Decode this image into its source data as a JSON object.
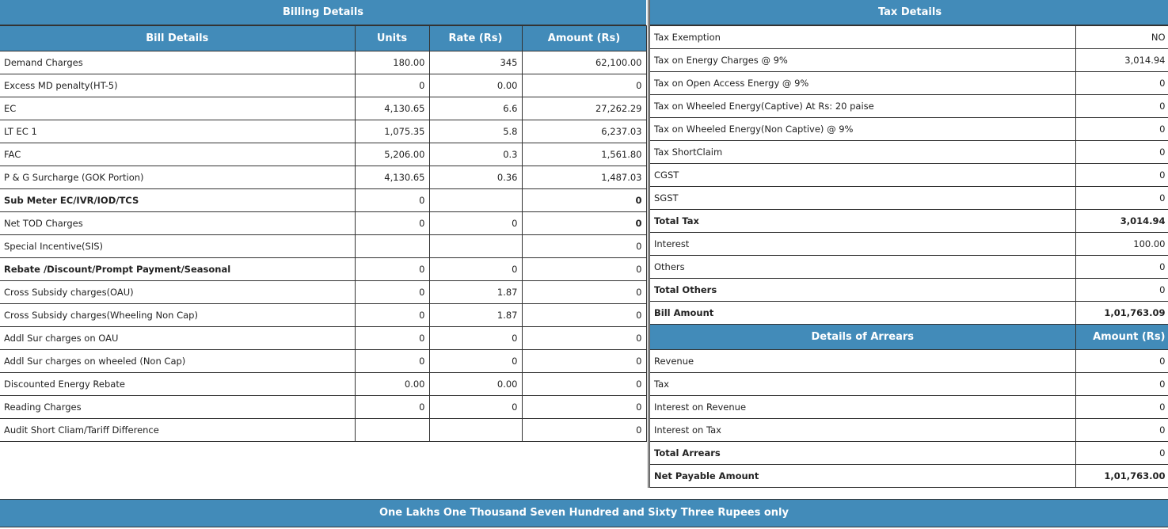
{
  "billing": {
    "title": "Billing Details",
    "columns": [
      "Bill Details",
      "Units",
      "Rate (Rs)",
      "Amount (Rs)"
    ],
    "rows": [
      {
        "label": "Demand Charges",
        "units": "180.00",
        "rate": "345",
        "amount": "62,100.00"
      },
      {
        "label": "Excess MD penalty(HT-5)",
        "units": "0",
        "rate": "0.00",
        "amount": "0"
      },
      {
        "label": "EC",
        "units": "4,130.65",
        "rate": "6.6",
        "amount": "27,262.29"
      },
      {
        "label": "LT EC 1",
        "units": "1,075.35",
        "rate": "5.8",
        "amount": "6,237.03"
      },
      {
        "label": "FAC",
        "units": "5,206.00",
        "rate": "0.3",
        "amount": "1,561.80"
      },
      {
        "label": "P & G Surcharge (GOK Portion)",
        "units": "4,130.65",
        "rate": "0.36",
        "amount": "1,487.03"
      },
      {
        "label": "Sub Meter EC/IVR/IOD/TCS",
        "units": "0",
        "rate": "",
        "amount": "0",
        "bold_label": true,
        "bold_amount": true
      },
      {
        "label": "Net TOD Charges",
        "units": "0",
        "rate": "0",
        "amount": "0",
        "bold_amount": true
      },
      {
        "label": "Special Incentive(SIS)",
        "units": "",
        "rate": "",
        "amount": "0"
      },
      {
        "label": "Rebate /Discount/Prompt Payment/Seasonal",
        "units": "0",
        "rate": "0",
        "amount": "0",
        "bold_label": true
      },
      {
        "label": "Cross Subsidy charges(OAU)",
        "units": "0",
        "rate": "1.87",
        "amount": "0"
      },
      {
        "label": "Cross Subsidy charges(Wheeling Non Cap)",
        "units": "0",
        "rate": "1.87",
        "amount": "0"
      },
      {
        "label": "Addl Sur charges on OAU",
        "units": "0",
        "rate": "0",
        "amount": "0"
      },
      {
        "label": "Addl Sur charges on wheeled (Non Cap)",
        "units": "0",
        "rate": "0",
        "amount": "0"
      },
      {
        "label": "Discounted Energy Rebate",
        "units": "0.00",
        "rate": "0.00",
        "amount": "0"
      },
      {
        "label": "Reading Charges",
        "units": "0",
        "rate": "0",
        "amount": "0"
      },
      {
        "label": "Audit Short Cliam/Tariff Difference",
        "units": "",
        "rate": "",
        "amount": "0"
      }
    ]
  },
  "tax": {
    "title": "Tax Details",
    "rows": [
      {
        "label": "Tax Exemption",
        "value": "NO"
      },
      {
        "label": "Tax on Energy Charges @ 9%",
        "value": "3,014.94"
      },
      {
        "label": "Tax on Open Access Energy @ 9%",
        "value": "0"
      },
      {
        "label": "Tax on Wheeled Energy(Captive) At Rs: 20 paise",
        "value": "0"
      },
      {
        "label": "Tax on Wheeled Energy(Non Captive) @ 9%",
        "value": "0"
      },
      {
        "label": "Tax ShortClaim",
        "value": "0"
      },
      {
        "label": "CGST",
        "value": "0"
      },
      {
        "label": "SGST",
        "value": "0"
      },
      {
        "label": "Total Tax",
        "value": "3,014.94",
        "bold": true
      },
      {
        "label": "Interest",
        "value": "100.00"
      },
      {
        "label": "Others",
        "value": "0"
      },
      {
        "label": "Total Others",
        "value": "0",
        "bold_label": true
      },
      {
        "label": "Bill Amount",
        "value": "1,01,763.09",
        "bold": true
      }
    ]
  },
  "arrears": {
    "title": "Details of Arrears",
    "amount_header": "Amount (Rs)",
    "rows": [
      {
        "label": "Revenue",
        "value": "0"
      },
      {
        "label": "Tax",
        "value": "0"
      },
      {
        "label": "Interest on Revenue",
        "value": "0"
      },
      {
        "label": "Interest on Tax",
        "value": "0"
      },
      {
        "label": "Total Arrears",
        "value": "0",
        "bold_label": true
      },
      {
        "label": "Net Payable Amount",
        "value": "1,01,763.00",
        "bold": true
      }
    ]
  },
  "amount_in_words": "One Lakhs One Thousand Seven Hundred and Sixty Three Rupees only",
  "colors": {
    "header": "#428bb9"
  }
}
